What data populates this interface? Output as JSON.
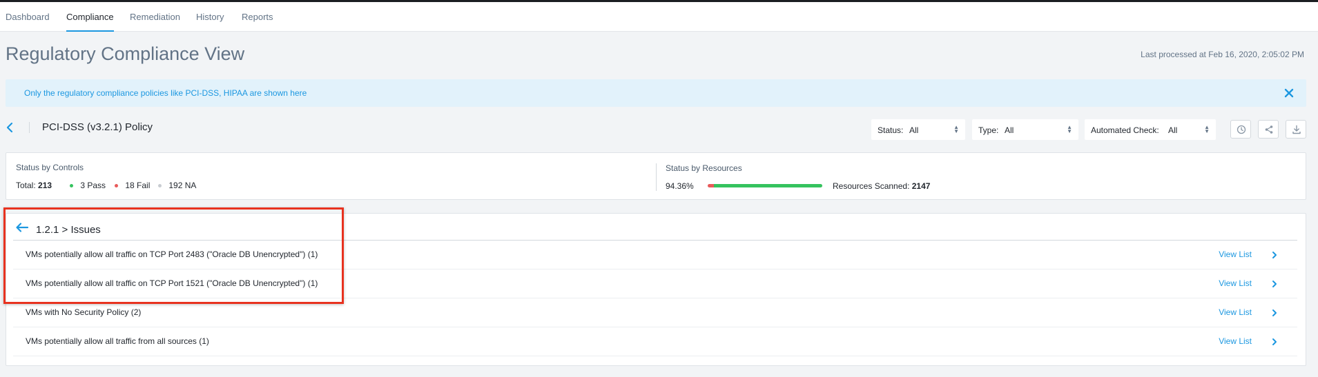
{
  "nav": {
    "tabs": [
      {
        "label": "Dashboard"
      },
      {
        "label": "Compliance",
        "active": true
      },
      {
        "label": "Remediation"
      },
      {
        "label": "History"
      },
      {
        "label": "Reports"
      }
    ]
  },
  "header": {
    "title": "Regulatory Compliance View",
    "last_processed": "Last processed at Feb 16, 2020, 2:05:02 PM"
  },
  "banner": {
    "text": "Only the regulatory compliance policies like PCI-DSS, HIPAA are shown here"
  },
  "policy": {
    "title": "PCI-DSS (v3.2.1) Policy"
  },
  "filters": [
    {
      "label": "Status:",
      "value": "All"
    },
    {
      "label": "Type:",
      "value": "All"
    },
    {
      "label": "Automated Check:",
      "value": "All"
    }
  ],
  "status_by_controls": {
    "title": "Status by Controls",
    "total_label": "Total:",
    "total_value": "213",
    "pass": "3 Pass",
    "fail": "18 Fail",
    "na": "192 NA"
  },
  "status_by_resources": {
    "title": "Status by Resources",
    "percent": "94.36%",
    "pass_fraction": 0.9436,
    "scanned_label": "Resources Scanned:",
    "scanned_value": "2147"
  },
  "issues": {
    "breadcrumb": "1.2.1 > Issues",
    "view_list_label": "View List",
    "rows": [
      {
        "label": "VMs potentially allow all traffic on TCP Port 2483 (\"Oracle DB Unencrypted\") (1)"
      },
      {
        "label": "VMs potentially allow all traffic on TCP Port 1521 (\"Oracle DB Unencrypted\") (1)"
      },
      {
        "label": "VMs with No Security Policy (2)"
      },
      {
        "label": "VMs potentially allow all traffic from all sources (1)"
      }
    ]
  },
  "colors": {
    "accent": "#1b97e0",
    "pass": "#35c35e",
    "fail": "#e85a5a",
    "na": "#c8ccd1",
    "highlight": "#e8321f"
  }
}
